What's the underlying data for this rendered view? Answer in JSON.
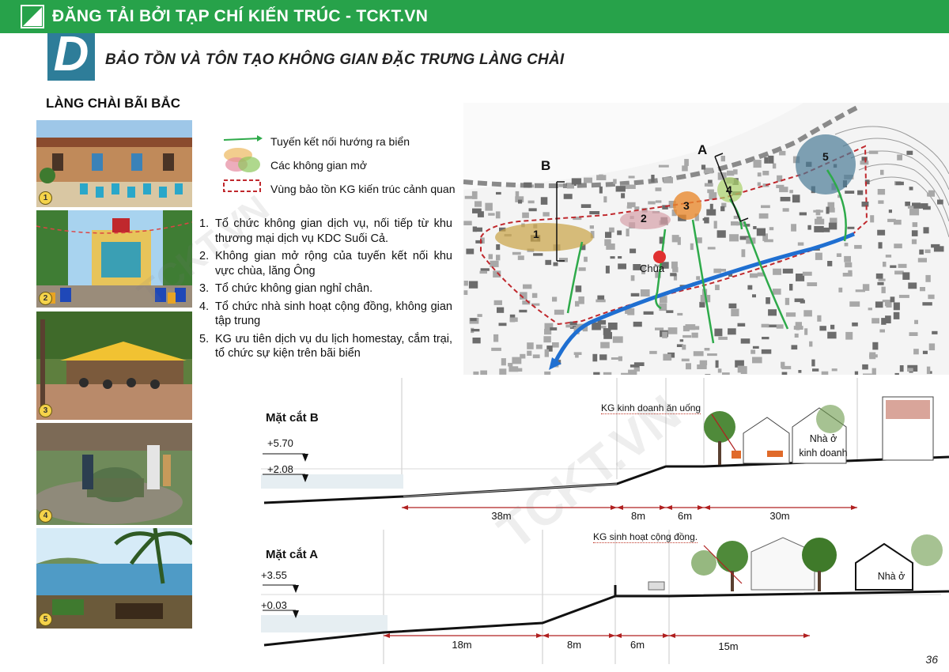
{
  "banner": {
    "text": "ĐĂNG TẢI BỞI TẠP CHÍ KIẾN TRÚC - TCKT.VN"
  },
  "header": {
    "letter": "D",
    "title": "BẢO TỒN VÀ TÔN TẠO KHÔNG GIAN ĐẶC TRƯNG LÀNG CHÀI"
  },
  "section_title": "LÀNG CHÀI BÃI BẮC",
  "photos": [
    {
      "num": "1"
    },
    {
      "num": "2"
    },
    {
      "num": "3"
    },
    {
      "num": "4"
    },
    {
      "num": "5"
    }
  ],
  "legend": {
    "link": "Tuyến kết nối hướng ra biển",
    "open": "Các không gian mở",
    "zone": "Vùng bảo tồn KG kiến trúc cảnh quan"
  },
  "list": [
    {
      "num": "1.",
      "text": "Tổ chức không gian dịch vụ, nối tiếp từ khu thương mại dịch vụ KDC Suối Cả."
    },
    {
      "num": "2.",
      "text": "Không gian mở rộng của tuyến kết nối khu vực chùa, lăng Ông"
    },
    {
      "num": "3.",
      "text": "Tổ chức không gian nghỉ chân."
    },
    {
      "num": "4.",
      "text": "Tổ chức nhà sinh hoạt cộng đồng, không gian tập trung"
    },
    {
      "num": "5.",
      "text": "KG ưu tiên dịch vụ du lịch homestay, cắm trại, tổ chức sự kiện trên bãi biển"
    }
  ],
  "map": {
    "label_a": "A",
    "label_b": "B",
    "temple": "Chùa",
    "zones": [
      "1",
      "2",
      "3",
      "4",
      "5"
    ]
  },
  "section_b": {
    "title": "Mặt cắt B",
    "levels": [
      "+5.70",
      "+2.08"
    ],
    "callout": "KG kinh doanh ăn uống",
    "building": [
      "Nhà ở",
      "kinh doanh"
    ],
    "dims": [
      "38m",
      "8m",
      "6m",
      "30m"
    ]
  },
  "section_a": {
    "title": "Mặt cắt A",
    "levels": [
      "+3.55",
      "+0.03"
    ],
    "callout": "KG sinh hoạt cộng đồng.",
    "building": "Nhà ở",
    "dims": [
      "18m",
      "8m",
      "6m",
      "15m"
    ]
  },
  "watermark": "TCKT.VN",
  "page_number": "36",
  "colors": {
    "banner": "#27a24a",
    "header_block": "#2e7d99",
    "link_line": "#2eaa4a",
    "road": "#1f6fd1",
    "zone_border": "#c0282d"
  }
}
